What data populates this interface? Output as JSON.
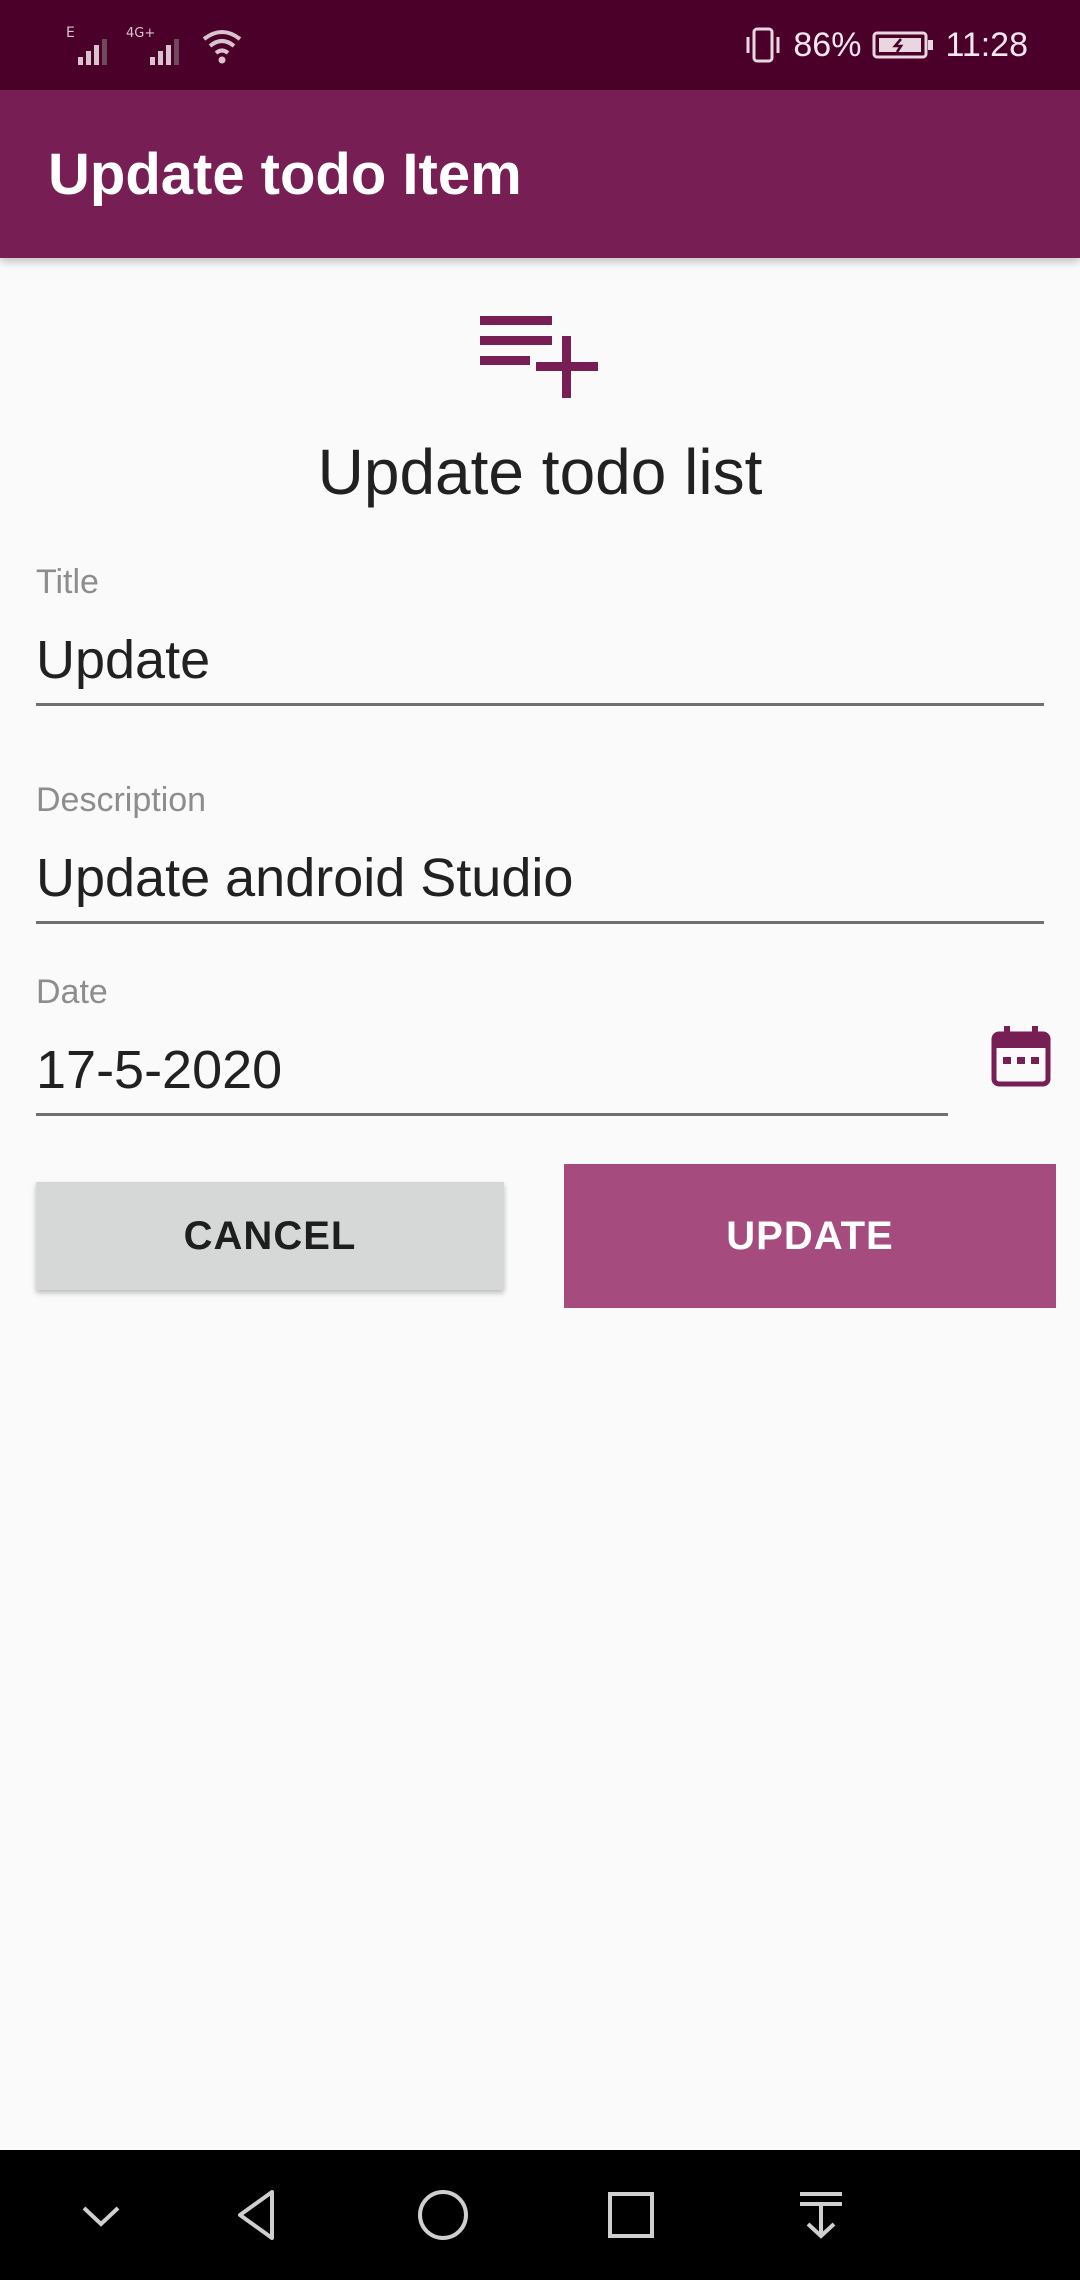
{
  "status_bar": {
    "network_1": "E",
    "network_2": "4G+",
    "battery_percent": "86%",
    "time": "11:28",
    "icons": [
      "signal-icon",
      "signal-icon",
      "wifi-icon",
      "vibrate-icon",
      "battery-charging-icon"
    ]
  },
  "app_bar": {
    "title": "Update todo Item"
  },
  "header": {
    "icon": "playlist-add-icon",
    "heading": "Update todo list"
  },
  "form": {
    "title": {
      "label": "Title",
      "value": "Update"
    },
    "description": {
      "label": "Description",
      "value": "Update android Studio"
    },
    "date": {
      "label": "Date",
      "value": "17-5-2020",
      "icon": "calendar-icon"
    }
  },
  "buttons": {
    "cancel": "CANCEL",
    "update": "UPDATE"
  },
  "nav_bar": {
    "icons": [
      "chevron-down-icon",
      "back-icon",
      "home-icon",
      "recents-icon",
      "notifications-pull-icon"
    ]
  },
  "colors": {
    "status_bar": "#4a0028",
    "app_bar": "#771f55",
    "accent": "#771f55",
    "update_button": "#a54b7d",
    "cancel_button": "#d6d7d7",
    "background": "#fafafa"
  }
}
